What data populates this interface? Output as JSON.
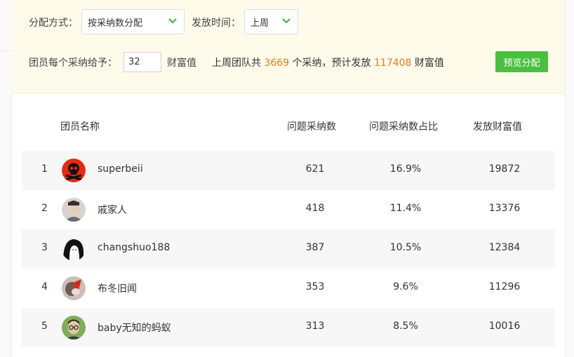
{
  "filters": {
    "method_label": "分配方式：",
    "method_value": "按采纳数分配",
    "time_label": "发放时间：",
    "time_value": "上周",
    "per_adopt_label": "团员每个采纳给予：",
    "per_adopt_value": "32",
    "per_adopt_unit": "财富值",
    "preview_button": "预览分配"
  },
  "summary": {
    "prefix": "上周团队共",
    "adopt_count": "3669",
    "middle": "个采纳，预计发放",
    "total_value": "117408",
    "suffix": "财富值",
    "accent_color": "#e07b1e"
  },
  "table": {
    "headers": [
      "团员名称",
      "问题采纳数",
      "问题采纳数占比",
      "发放财富值"
    ],
    "rows": [
      {
        "rank": "1",
        "name": "superbeii",
        "count": "621",
        "ratio": "16.9%",
        "value": "19872",
        "avatar": "skull-avatar-icon"
      },
      {
        "rank": "2",
        "name": "戚家人",
        "count": "418",
        "ratio": "11.4%",
        "value": "13376",
        "avatar": "portrait-avatar-icon"
      },
      {
        "rank": "3",
        "name": "changshuo188",
        "count": "387",
        "ratio": "10.5%",
        "value": "12384",
        "avatar": "sketch-face-avatar-icon"
      },
      {
        "rank": "4",
        "name": "布冬旧闻",
        "count": "353",
        "ratio": "9.6%",
        "value": "11296",
        "avatar": "photo-avatar-icon"
      },
      {
        "rank": "5",
        "name": "baby无知的蚂蚁",
        "count": "313",
        "ratio": "8.5%",
        "value": "10016",
        "avatar": "glasses-avatar-icon"
      }
    ]
  },
  "colors": {
    "panel_bg": "#fffbeb",
    "button_green": "#4bbf3f",
    "chevron_green": "#3bb83b"
  }
}
